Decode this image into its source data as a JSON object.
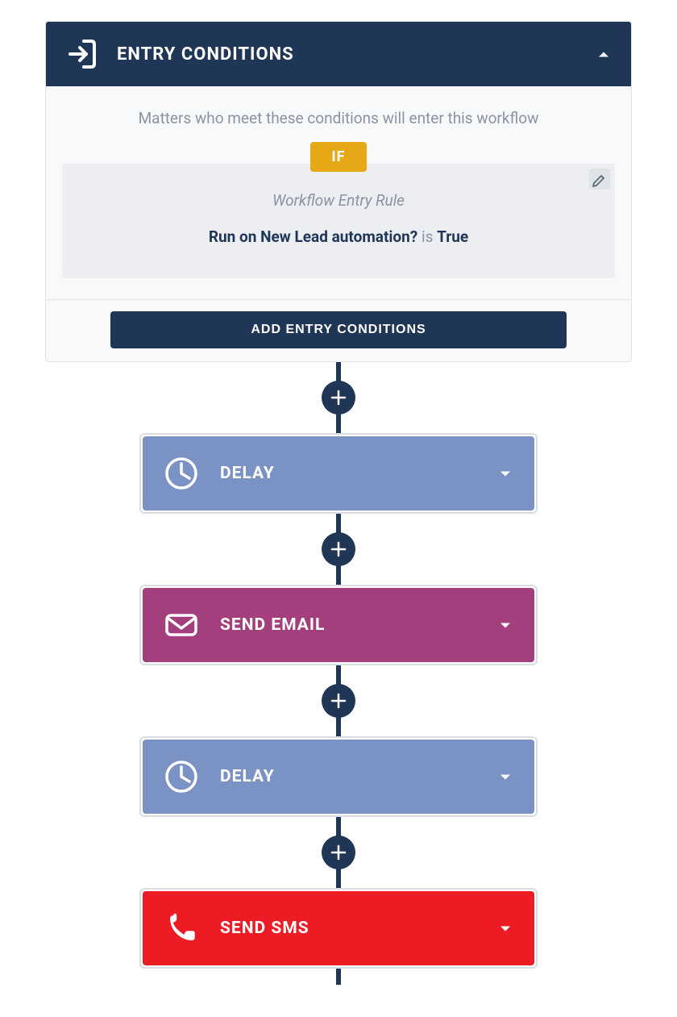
{
  "entry_conditions": {
    "title": "ENTRY CONDITIONS",
    "description": "Matters who meet these conditions will enter this workflow",
    "if_label": "IF",
    "rule_name": "Workflow Entry Rule",
    "rule_field": "Run on New Lead automation?",
    "rule_operator": "is",
    "rule_value": "True",
    "add_button_label": "ADD ENTRY CONDITIONS"
  },
  "steps": [
    {
      "type": "delay",
      "label": "DELAY",
      "icon": "clock-icon",
      "bg": "bg-delay"
    },
    {
      "type": "email",
      "label": "SEND EMAIL",
      "icon": "envelope-icon",
      "bg": "bg-email"
    },
    {
      "type": "delay",
      "label": "DELAY",
      "icon": "clock-icon",
      "bg": "bg-delay"
    },
    {
      "type": "sms",
      "label": "SEND SMS",
      "icon": "phone-icon",
      "bg": "bg-sms"
    }
  ],
  "icons": {
    "entry": "entry-icon",
    "plus": "plus-icon"
  }
}
